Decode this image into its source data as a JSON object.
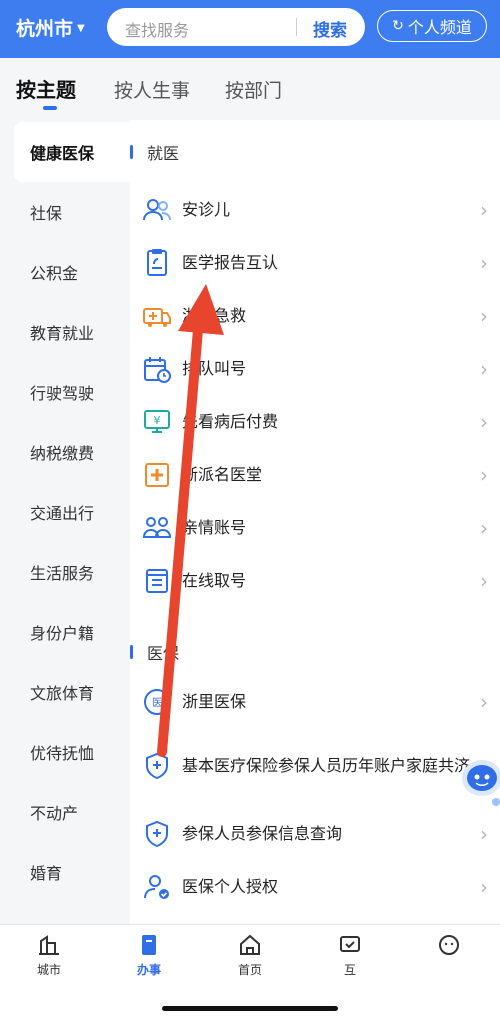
{
  "header": {
    "city": "杭州市",
    "search_placeholder": "查找服务",
    "search_button": "搜索",
    "channel_button": "个人频道"
  },
  "tabs": [
    {
      "label": "按主题",
      "active": true
    },
    {
      "label": "按人生事",
      "active": false
    },
    {
      "label": "按部门",
      "active": false
    }
  ],
  "sidebar": {
    "items": [
      {
        "label": "健康医保",
        "active": true
      },
      {
        "label": "社保"
      },
      {
        "label": "公积金"
      },
      {
        "label": "教育就业"
      },
      {
        "label": "行驶驾驶"
      },
      {
        "label": "纳税缴费"
      },
      {
        "label": "交通出行"
      },
      {
        "label": "生活服务"
      },
      {
        "label": "身份户籍"
      },
      {
        "label": "文旅体育"
      },
      {
        "label": "优待抚恤"
      },
      {
        "label": "不动产"
      },
      {
        "label": "婚育"
      }
    ]
  },
  "sections": [
    {
      "title": "就医",
      "items": [
        {
          "label": "安诊儿",
          "icon": "people-icon"
        },
        {
          "label": "医学报告互认",
          "icon": "report-icon"
        },
        {
          "label": "浙里急救",
          "icon": "ambulance-icon"
        },
        {
          "label": "排队叫号",
          "icon": "calendar-clock-icon"
        },
        {
          "label": "先看病后付费",
          "icon": "yuan-monitor-icon"
        },
        {
          "label": "浙派名医堂",
          "icon": "clinic-icon"
        },
        {
          "label": "亲情账号",
          "icon": "family-icon"
        },
        {
          "label": "在线取号",
          "icon": "ticket-icon"
        }
      ]
    },
    {
      "title": "医保",
      "items": [
        {
          "label": "浙里医保",
          "icon": "medical-insurance-icon"
        },
        {
          "label": "基本医疗保险参保人员历年账户家庭共济",
          "icon": "shield-plus-icon"
        },
        {
          "label": "参保人员参保信息查询",
          "icon": "shield-search-icon"
        },
        {
          "label": "医保个人授权",
          "icon": "user-auth-icon"
        }
      ]
    }
  ],
  "bottom_nav": [
    {
      "label": "城市",
      "icon": "city-icon",
      "active": false
    },
    {
      "label": "办事",
      "icon": "affairs-icon",
      "active": true
    },
    {
      "label": "首页",
      "icon": "home-icon",
      "active": false
    },
    {
      "label": "互",
      "icon": "interact-icon",
      "active": false
    },
    {
      "label": "",
      "icon": "mine-icon",
      "active": false
    }
  ],
  "colors": {
    "primary": "#3d7df0",
    "accent": "#2f6ee6",
    "icon_blue": "#2f6ee6",
    "icon_orange": "#f08a2e",
    "arrow_red": "#e8452f"
  }
}
